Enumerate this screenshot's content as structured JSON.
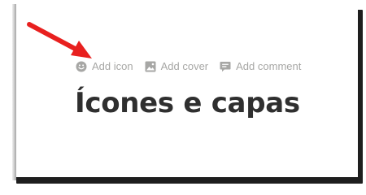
{
  "page": {
    "actions": [
      {
        "label": "Add icon",
        "icon": "smiley-icon"
      },
      {
        "label": "Add cover",
        "icon": "image-icon"
      },
      {
        "label": "Add comment",
        "icon": "comment-icon"
      }
    ],
    "title": "Ícones e capas"
  },
  "annotation": {
    "icon": "red-arrow-icon",
    "color": "#e8201f"
  },
  "colors": {
    "action_text": "#a7a7a5",
    "title": "#2f2f2f",
    "shadow": "#1e1e1e"
  }
}
